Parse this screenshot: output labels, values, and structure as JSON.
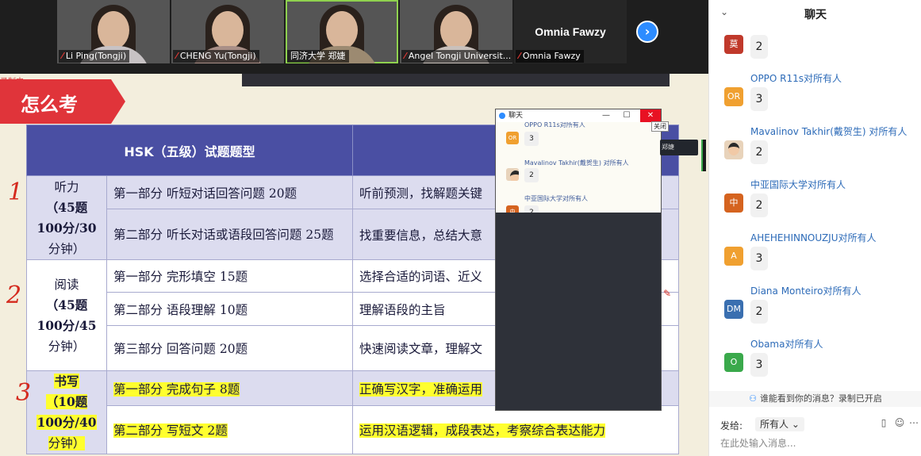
{
  "participants": [
    {
      "name": "Li Ping(Tongji)",
      "muted": true,
      "body_color": "#c7c2c4"
    },
    {
      "name": "CHENG Yu(Tongji)",
      "muted": true,
      "body_color": "#a98f87"
    },
    {
      "name": "同济大学 郑婕",
      "muted": false,
      "body_color": "#9c8a71"
    },
    {
      "name": "Angel Tongji Universit...",
      "muted": true,
      "body_color": "#c9c0bb"
    },
    {
      "name": "Omnia Fawzy",
      "muted": true,
      "display_text": "Omnia Fawzy"
    }
  ],
  "next_icon": "chevron-right-icon",
  "recording_label": "录制中",
  "slide": {
    "title": "怎么考",
    "headers": [
      "HSK（五级）试题题型",
      "能"
    ],
    "sections": [
      {
        "label": [
          "听力",
          "（45题",
          "100分/30",
          "分钟）"
        ],
        "rows": [
          {
            "part": "第一部分 听短对话回答问题 20题",
            "skill": "听前预测，找解题关键"
          },
          {
            "part": "第二部分 听长对话或语段回答问题 25题",
            "skill": "找重要信息，总结大意"
          }
        ]
      },
      {
        "label": [
          "阅读",
          "（45题",
          "100分/45",
          "分钟）"
        ],
        "rows": [
          {
            "part": "第一部分 完形填空 15题",
            "skill": "选择合适的词语、近义"
          },
          {
            "part": "第二部分 语段理解 10题",
            "skill": "理解语段的主旨"
          },
          {
            "part": "第三部分 回答问题 20题",
            "skill": "快速阅读文章，理解文"
          }
        ]
      },
      {
        "label": [
          "书写",
          "（10题",
          "100分/40",
          "分钟）"
        ],
        "rows": [
          {
            "part": "第一部分 完成句子 8题",
            "skill": "正确写汉字，准确运用"
          },
          {
            "part": "第二部分 写短文 2题",
            "skill": "运用汉语逻辑，成段表达，考察综合表达能力"
          }
        ]
      }
    ],
    "marks": [
      "1",
      "2",
      "3"
    ]
  },
  "floating_chat": {
    "title": "聊天",
    "controls": [
      "—",
      "☐",
      "✕"
    ],
    "close_tooltip": "关闭",
    "messages": [
      {
        "head": "OPPO R11s对所有人",
        "avatar": "OR",
        "avatar_color": "#f0a030",
        "text": "3"
      },
      {
        "head": "Mavalinov Takhir(戴贺生) 对所有人",
        "avatar": "",
        "avatar_color": "#e8d3bb",
        "text": "2"
      },
      {
        "head": "中亚国际大学对所有人",
        "avatar": "中",
        "avatar_color": "#d5631f",
        "text": "2"
      }
    ],
    "side_tag": "郑婕"
  },
  "chat_panel": {
    "title": "聊天",
    "messages": [
      {
        "sender": "",
        "to": "",
        "avatar": "莫",
        "avatar_color": "#c0392b",
        "text": "2",
        "photo": false
      },
      {
        "sender": "OPPO R11s",
        "to": "对所有人",
        "avatar": "OR",
        "avatar_color": "#f0a030",
        "text": "3",
        "photo": false
      },
      {
        "sender": "Mavalinov Takhir(戴贺生)",
        "to": " 对所有人",
        "avatar": "",
        "avatar_color": "#e8d3bb",
        "text": "2",
        "photo": true
      },
      {
        "sender": "中亚国际大学",
        "to": "对所有人",
        "avatar": "中",
        "avatar_color": "#d5631f",
        "text": "2",
        "photo": false
      },
      {
        "sender": "AHEHEHINNOUZJU",
        "to": "对所有人",
        "avatar": "A",
        "avatar_color": "#f0a030",
        "text": "3",
        "photo": false
      },
      {
        "sender": "Diana Monteiro",
        "to": "对所有人",
        "avatar": "DM",
        "avatar_color": "#3a6fb0",
        "text": "2",
        "photo": false
      },
      {
        "sender": "Obama",
        "to": "对所有人",
        "avatar": "O",
        "avatar_color": "#3aa94b",
        "text": "3",
        "photo": false
      }
    ],
    "recording_note": "谁能看到你的消息？录制已开启",
    "send_label": "发给:",
    "recipient": "所有人",
    "input_placeholder": "在此处输入消息..."
  }
}
